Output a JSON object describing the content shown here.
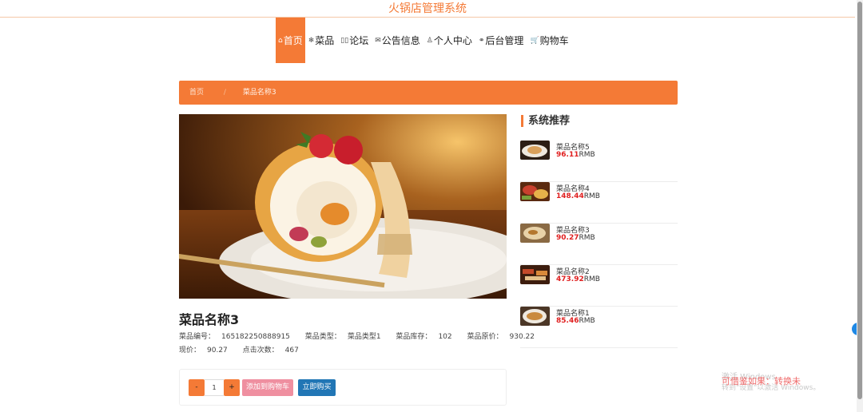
{
  "header": {
    "site_title": "火锅店管理系统"
  },
  "nav": {
    "items": [
      {
        "icon": "home-icon",
        "glyph": "⌂",
        "label": "首页",
        "active": true
      },
      {
        "icon": "snowflake-icon",
        "glyph": "❄",
        "label": "菜品"
      },
      {
        "icon": "forum-icon",
        "glyph": "▯▯",
        "label": "论坛"
      },
      {
        "icon": "mail-icon",
        "glyph": "✉",
        "label": "公告信息"
      },
      {
        "icon": "user-icon",
        "glyph": "♙",
        "label": "个人中心"
      },
      {
        "icon": "link-icon",
        "glyph": "⚭",
        "label": "后台管理"
      },
      {
        "icon": "cart-icon",
        "glyph": "🛒",
        "label": "购物车"
      }
    ]
  },
  "breadcrumb": {
    "home": "首页",
    "separator": "/",
    "current": "菜品名称3"
  },
  "dish": {
    "name": "菜品名称3",
    "id_label": "菜品编号：",
    "id_value": "165182250888915",
    "type_label": "菜品类型：",
    "type_value": "菜品类型1",
    "stock_label": "菜品库存：",
    "stock_value": "102",
    "orig_price_label": "菜品原价：",
    "orig_price_value": "930.22",
    "price_label": "现价：",
    "price_value": "90.27",
    "clicks_label": "点击次数：",
    "clicks_value": "467"
  },
  "purchase": {
    "minus": "-",
    "quantity": "1",
    "plus": "+",
    "add_to_cart": "添加到购物车",
    "buy_now": "立即购买"
  },
  "recommend": {
    "title": "系统推荐",
    "unit": "RMB",
    "items": [
      {
        "name": "菜品名称5",
        "price": "96.11"
      },
      {
        "name": "菜品名称4",
        "price": "148.44"
      },
      {
        "name": "菜品名称3",
        "price": "90.27"
      },
      {
        "name": "菜品名称2",
        "price": "473.92"
      },
      {
        "name": "菜品名称1",
        "price": "85.46"
      }
    ]
  },
  "overlay": {
    "activate_line1": "激活 Windows",
    "activate_line2": "转到\"设置\"以激活 Windows。",
    "watermark": "可借鉴如果：转换未"
  },
  "colors": {
    "accent": "#f47a36",
    "price_red": "#e02020",
    "buy_blue": "#2176b5",
    "cart_pink": "#ef8fa0"
  }
}
